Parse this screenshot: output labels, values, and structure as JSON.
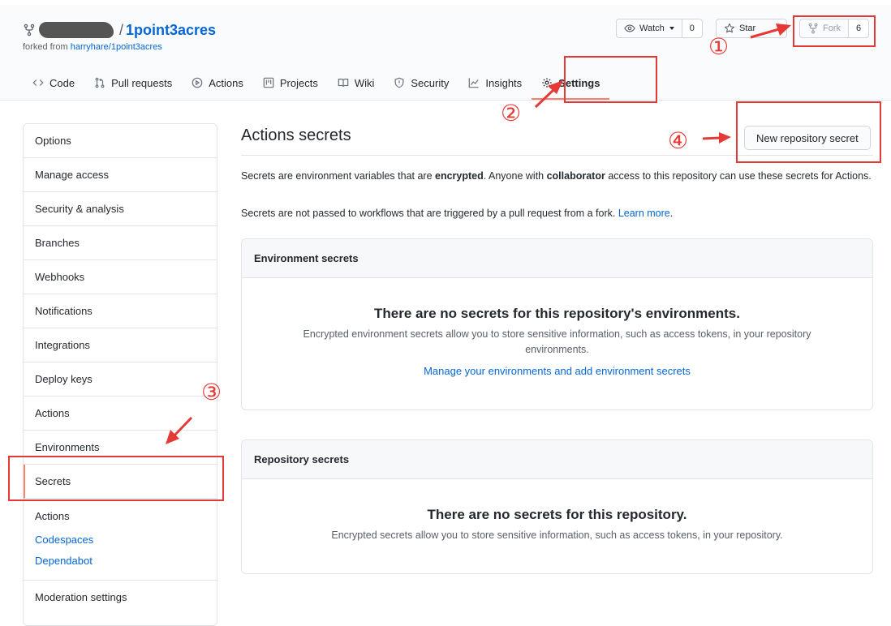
{
  "repo": {
    "name": "1point3acres",
    "separator": "/",
    "forked_prefix": "forked from",
    "forked_source": "harryhare/1point3acres"
  },
  "actions": {
    "watch": {
      "label": "Watch",
      "count": "0"
    },
    "star": {
      "label": "Star"
    },
    "fork": {
      "label": "Fork",
      "count": "6"
    }
  },
  "tabs": [
    {
      "label": "Code",
      "icon": "code-icon"
    },
    {
      "label": "Pull requests",
      "icon": "pull-request-icon"
    },
    {
      "label": "Actions",
      "icon": "play-icon"
    },
    {
      "label": "Projects",
      "icon": "project-icon"
    },
    {
      "label": "Wiki",
      "icon": "book-icon"
    },
    {
      "label": "Security",
      "icon": "shield-icon"
    },
    {
      "label": "Insights",
      "icon": "graph-icon"
    },
    {
      "label": "Settings",
      "icon": "gear-icon",
      "selected": true
    }
  ],
  "sidebar": {
    "items": [
      {
        "label": "Options"
      },
      {
        "label": "Manage access"
      },
      {
        "label": "Security & analysis"
      },
      {
        "label": "Branches"
      },
      {
        "label": "Webhooks"
      },
      {
        "label": "Notifications"
      },
      {
        "label": "Integrations"
      },
      {
        "label": "Deploy keys"
      },
      {
        "label": "Actions"
      },
      {
        "label": "Environments"
      },
      {
        "label": "Secrets",
        "selected": true
      }
    ],
    "secrets_sub": {
      "head": "Actions",
      "links": [
        "Codespaces",
        "Dependabot"
      ]
    },
    "bottom": {
      "label": "Moderation settings"
    }
  },
  "main": {
    "title": "Actions secrets",
    "new_button": "New repository secret",
    "desc1": {
      "a": "Secrets are environment variables that are ",
      "b": "encrypted",
      "c": ". Anyone with ",
      "d": "collaborator",
      "e": " access to this repository can use these secrets for Actions."
    },
    "desc2": {
      "text": "Secrets are not passed to workflows that are triggered by a pull request from a fork. ",
      "link": "Learn more",
      "end": "."
    },
    "env_box": {
      "header": "Environment secrets",
      "title": "There are no secrets for this repository's environments.",
      "body": "Encrypted environment secrets allow you to store sensitive information, such as access tokens, in your repository environments.",
      "link": "Manage your environments and add environment secrets"
    },
    "repo_box": {
      "header": "Repository secrets",
      "title": "There are no secrets for this repository.",
      "body": "Encrypted secrets allow you to store sensitive information, such as access tokens, in your repository."
    }
  },
  "annotations": {
    "step1": "①",
    "step2": "②",
    "step3": "③",
    "step4": "④",
    "color": "#e53935"
  }
}
